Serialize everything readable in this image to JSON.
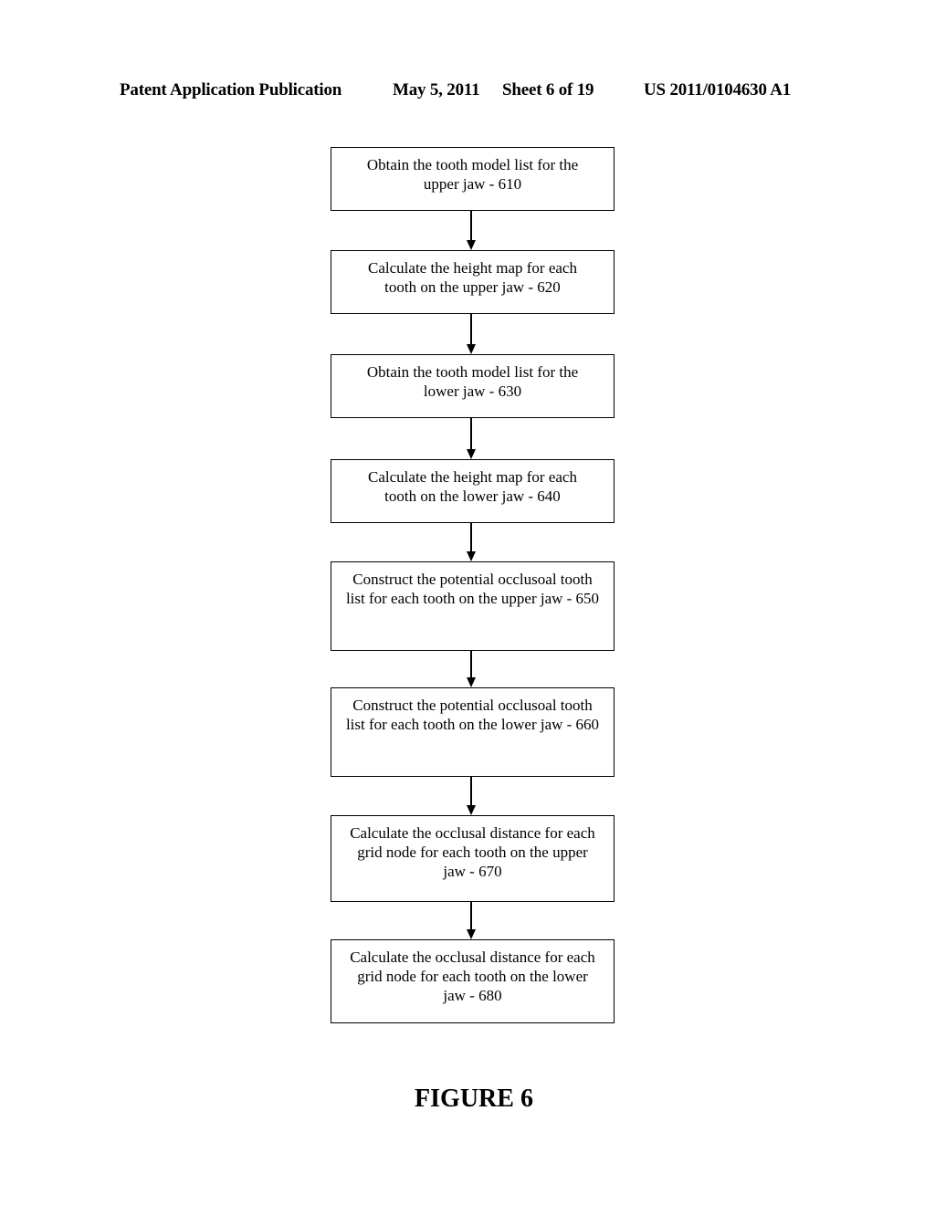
{
  "header": {
    "publication": "Patent Application Publication",
    "date": "May 5, 2011",
    "sheet": "Sheet 6 of 19",
    "number": "US 2011/0104630 A1"
  },
  "flowchart": {
    "steps": [
      {
        "id": "610",
        "text": "Obtain the tooth model list for the upper jaw - 610"
      },
      {
        "id": "620",
        "text": "Calculate the height map for each tooth on the upper jaw - 620"
      },
      {
        "id": "630",
        "text": "Obtain the tooth model list for the lower jaw - 630"
      },
      {
        "id": "640",
        "text": "Calculate the height map for each tooth on the lower jaw - 640"
      },
      {
        "id": "650",
        "text": "Construct the potential occlusoal tooth list for each tooth on the upper jaw - 650"
      },
      {
        "id": "660",
        "text": "Construct the potential occlusoal tooth list for each tooth on the lower jaw - 660"
      },
      {
        "id": "670",
        "text": "Calculate the occlusal distance for each grid node for each tooth on the upper jaw - 670"
      },
      {
        "id": "680",
        "text": "Calculate the occlusal distance for each grid node for each tooth on the lower jaw - 680"
      }
    ],
    "edges": [
      [
        "610",
        "620"
      ],
      [
        "620",
        "630"
      ],
      [
        "630",
        "640"
      ],
      [
        "640",
        "650"
      ],
      [
        "650",
        "660"
      ],
      [
        "660",
        "670"
      ],
      [
        "670",
        "680"
      ]
    ]
  },
  "figure_label": "FIGURE 6"
}
